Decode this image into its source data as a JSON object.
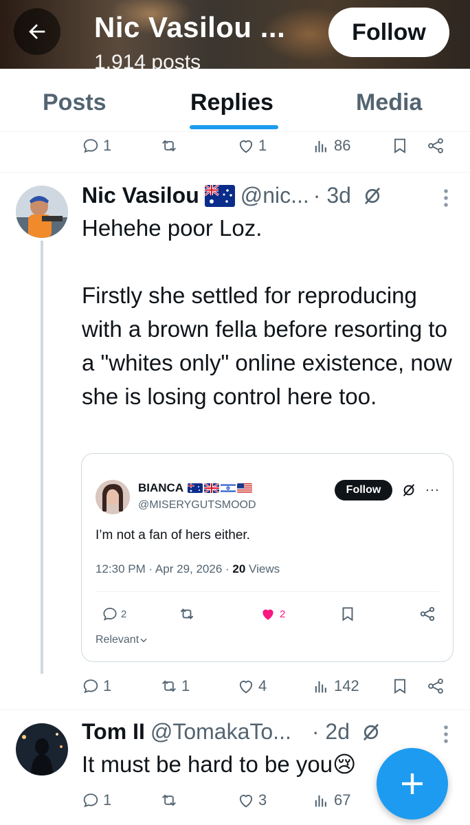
{
  "header": {
    "title": "Nic Vasilou ...",
    "subtitle": "1,914 posts",
    "follow_label": "Follow"
  },
  "tabs": [
    {
      "label": "Posts",
      "active": false
    },
    {
      "label": "Replies",
      "active": true
    },
    {
      "label": "Media",
      "active": false
    }
  ],
  "top_actions": {
    "replies": "1",
    "reposts": "",
    "likes": "1",
    "views": "86"
  },
  "tweets": [
    {
      "name": "Nic Vasilou",
      "flag": "australia-flag",
      "handle": "@nic...",
      "time": "· 3d",
      "text": "Hehehe poor Loz.\n\nFirstly she settled for reproducing with a brown fella before resorting to a \"whites only\" online existence, now she is losing control here too.",
      "embed": {
        "name": "BIANCA",
        "flags": [
          "australia-flag",
          "uk-flag",
          "israel-flag",
          "usa-flag"
        ],
        "handle": "@MISERYGUTSMOOD",
        "follow_label": "Follow",
        "more": "···",
        "text": "I’m not a fan of hers either.",
        "meta_time": "12:30 PM · Apr 29, 2026 · ",
        "meta_views_count": "20",
        "meta_views_label": " Views",
        "replies": "2",
        "likes": "2",
        "relevant_label": "Relevant"
      },
      "actions": {
        "replies": "1",
        "reposts": "1",
        "likes": "4",
        "views": "142"
      }
    },
    {
      "name": "Tom II",
      "handle": "@TomakaTo...",
      "time": "· 2d",
      "text": "It must be hard to be you",
      "emoji": "😢",
      "actions": {
        "replies": "1",
        "reposts": "",
        "likes": "3",
        "views": "67"
      }
    }
  ],
  "colors": {
    "accent": "#1d9bf0",
    "like": "#f91880",
    "text": "#0f1419",
    "muted": "#536471"
  },
  "fab_icon": "plus-icon"
}
